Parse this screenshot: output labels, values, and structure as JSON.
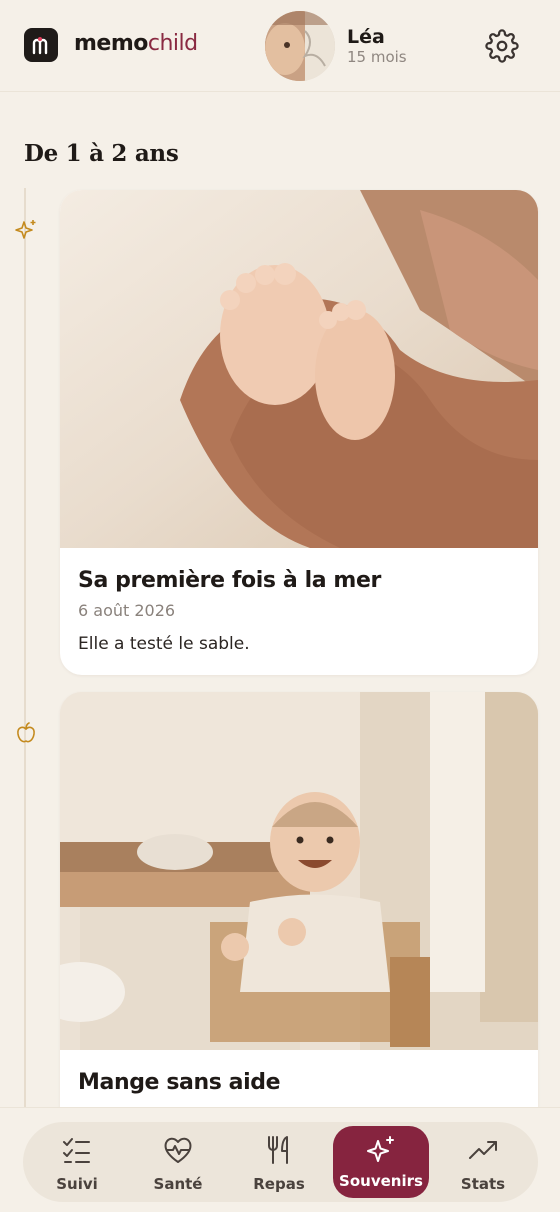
{
  "header": {
    "brand_bold": "memo",
    "brand_light": "child",
    "child_name": "Léa",
    "child_age": "15 mois"
  },
  "section": {
    "title": "De 1 à 2 ans"
  },
  "memories": [
    {
      "title": "Sa première fois à la mer",
      "date": "6 août 2026",
      "note": "Elle a testé le sable.",
      "icon": "sparkle-icon",
      "photo": "baby-feet-in-hands"
    },
    {
      "title": "Mange sans aide",
      "icon": "apple-icon",
      "photo": "baby-eating-in-high-chair"
    }
  ],
  "nav": {
    "items": [
      {
        "label": "Suivi",
        "icon": "checklist-icon"
      },
      {
        "label": "Santé",
        "icon": "heart-pulse-icon"
      },
      {
        "label": "Repas",
        "icon": "utensils-icon"
      },
      {
        "label": "Souvenirs",
        "icon": "sparkles-icon",
        "active": true
      },
      {
        "label": "Stats",
        "icon": "trend-icon"
      }
    ]
  },
  "colors": {
    "background": "#f5f0e8",
    "accent": "#86243f",
    "timeline_icon": "#c48a1e"
  }
}
